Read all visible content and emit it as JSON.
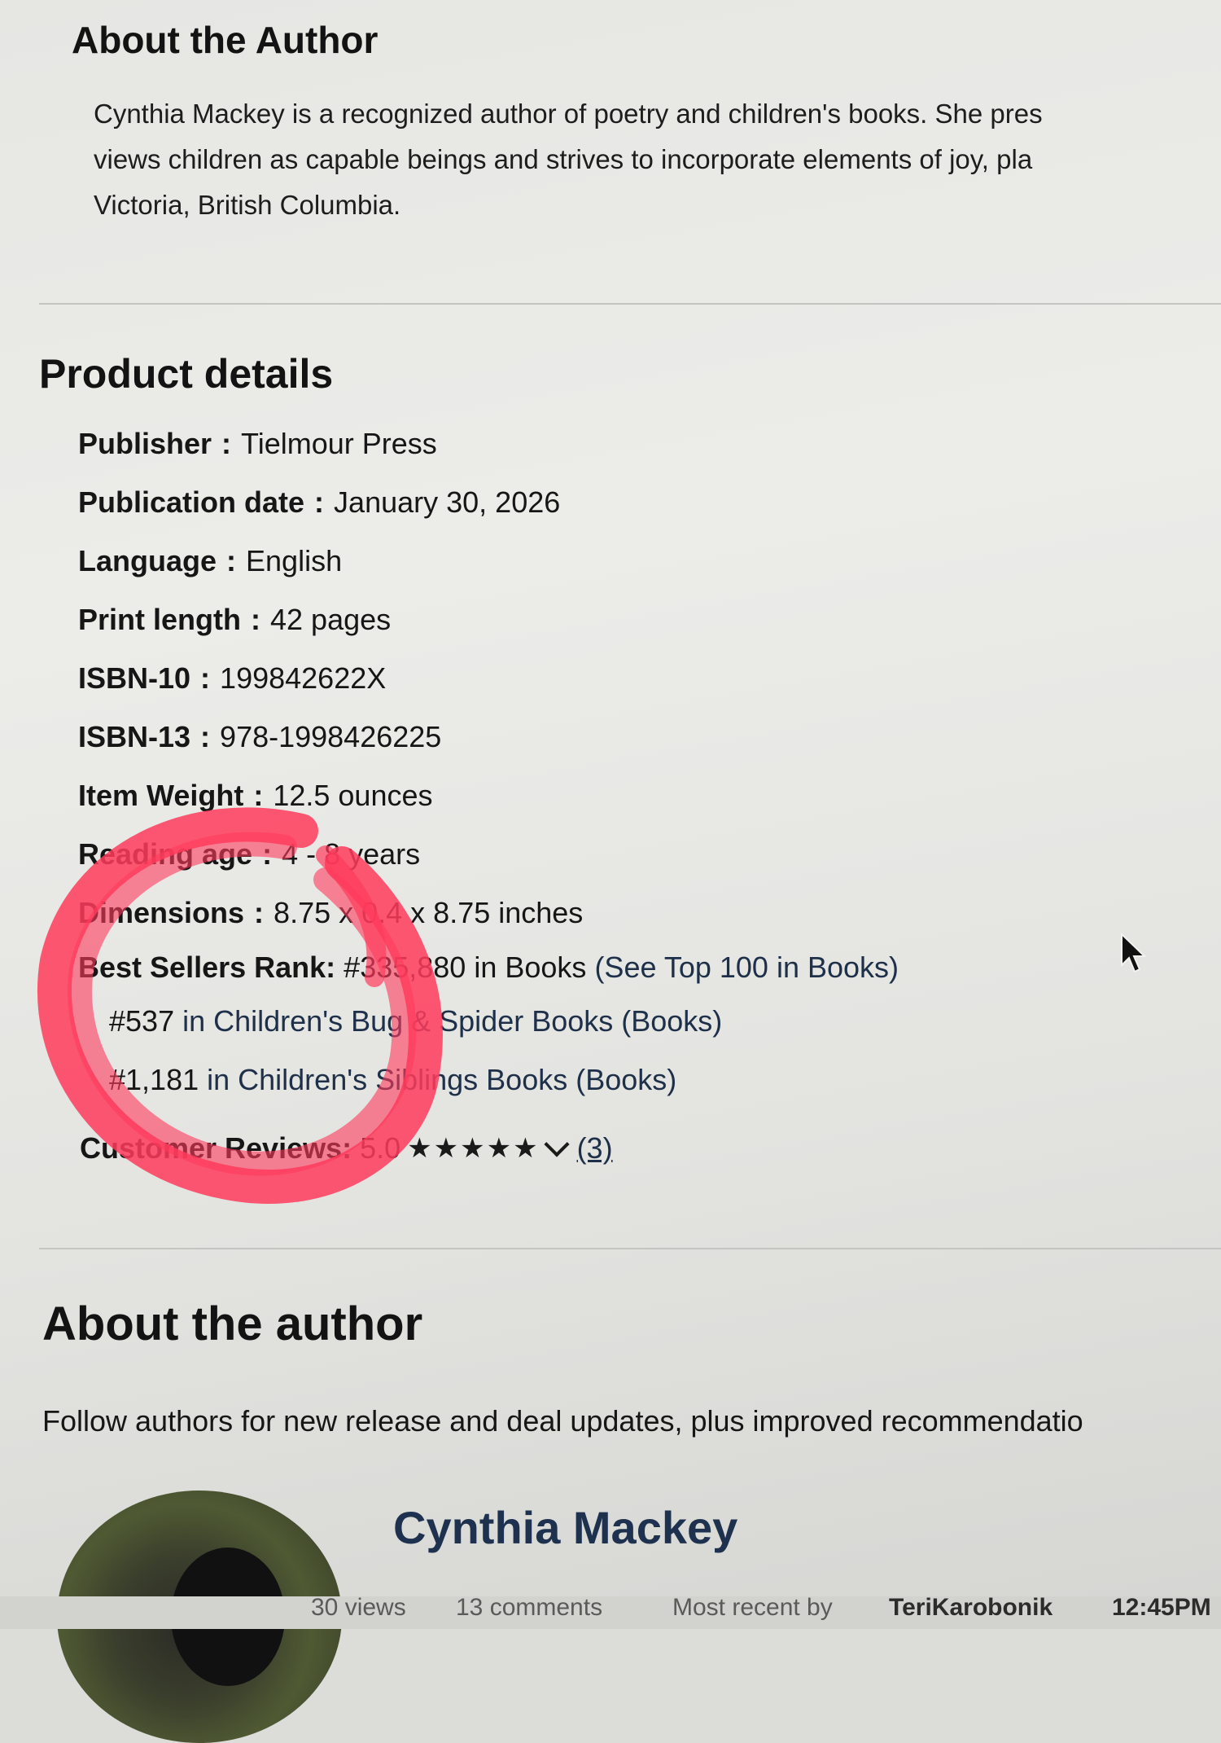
{
  "about_author_top": {
    "title": "About the Author",
    "bio_lines": [
      "Cynthia Mackey is a recognized author of poetry and children's books. She pres",
      "views children as capable beings and strives to incorporate elements of joy, pla",
      "Victoria, British Columbia."
    ]
  },
  "product_details": {
    "title": "Product details",
    "rows": [
      {
        "label": "Publisher",
        "value": "Tielmour Press"
      },
      {
        "label": "Publication date",
        "value": "January 30, 2026"
      },
      {
        "label": "Language",
        "value": "English"
      },
      {
        "label": "Print length",
        "value": "42 pages"
      },
      {
        "label": "ISBN-10",
        "value": "199842622X"
      },
      {
        "label": "ISBN-13",
        "value": "978-1998426225"
      },
      {
        "label": "Item Weight",
        "value": "12.5 ounces"
      },
      {
        "label": "Reading age",
        "value": "4 - 8 years"
      },
      {
        "label": "Dimensions",
        "value": "8.75 x 0.4 x 8.75 inches"
      }
    ],
    "best_sellers": {
      "label": "Best Sellers Rank:",
      "main_rank": "#335,880",
      "main_category": "in Books",
      "top100_link": "(See Top 100 in Books)",
      "sub_ranks": [
        {
          "rank": "#537",
          "category": "in Children's Bug & Spider Books (Books)"
        },
        {
          "rank": "#1,181",
          "category": "in Children's Siblings Books (Books)"
        }
      ]
    },
    "reviews": {
      "label": "Customer Reviews:",
      "rating": "5.0",
      "stars": "★★★★★",
      "count": "(3)"
    }
  },
  "about_author_bottom": {
    "title": "About the author",
    "follow_text": "Follow authors for new release and deal updates, plus improved recommendatio",
    "author_name": "Cynthia Mackey"
  },
  "footer": {
    "views": "30 views",
    "comments": "13 comments",
    "recent_prefix": "Most recent by",
    "recent_user": "TeriKarobonik",
    "time": "12:45PM"
  },
  "colors": {
    "scribble": "#ff3b5c",
    "link": "#1d2f49"
  },
  "icons": [
    "mouse-pointer-icon",
    "chevron-down-icon",
    "star-icon"
  ]
}
